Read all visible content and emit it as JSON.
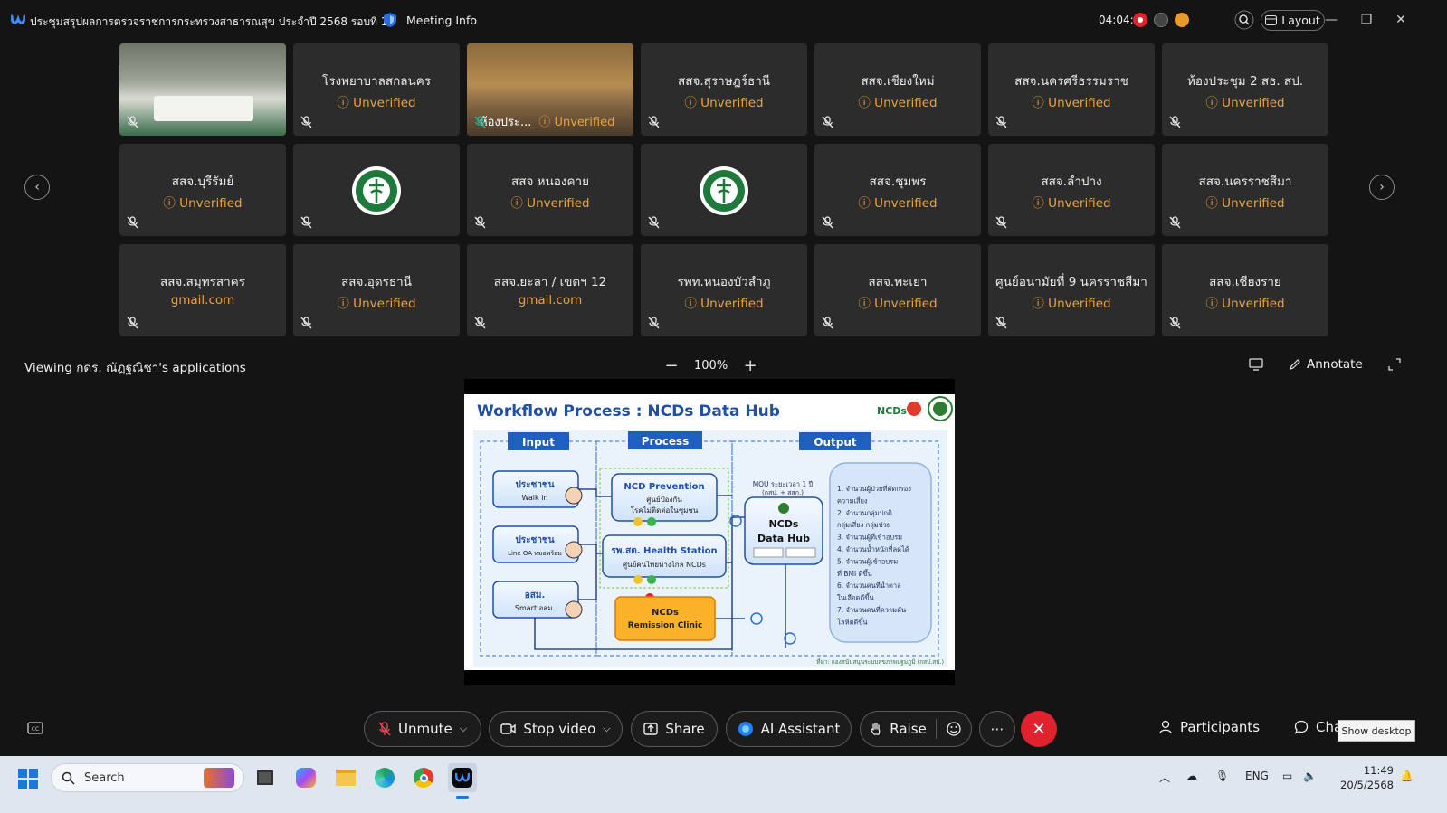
{
  "window": {
    "title": "ประชุมสรุปผลการตรวจราชการกระทรวงสาธารณสุข ประจำปี 2568 รอบที่ 1",
    "meeting_info": "Meeting Info",
    "timer": "04:04:44",
    "layout": "Layout"
  },
  "tiles": [
    {
      "name": "",
      "sub": "",
      "kind": "video-room"
    },
    {
      "name": "โรงพยาบาลสกลนคร",
      "sub": "ⓘ Unverified"
    },
    {
      "name": "ห้องประ...",
      "sub": "ⓘ Unverified",
      "kind": "video-active"
    },
    {
      "name": "สสจ.สุราษฎร์ธานี",
      "sub": "ⓘ Unverified"
    },
    {
      "name": "สสจ.เชียงใหม่",
      "sub": "ⓘ Unverified"
    },
    {
      "name": "สสจ.นครศรีธรรมราช",
      "sub": "ⓘ Unverified"
    },
    {
      "name": "ห้องประชุม 2 สธ. สป.",
      "sub": "ⓘ Unverified"
    },
    {
      "name": "สสจ.บุรีรัมย์",
      "sub": "ⓘ Unverified"
    },
    {
      "name": "",
      "sub": "",
      "kind": "logo"
    },
    {
      "name": "สสจ หนองคาย",
      "sub": "ⓘ Unverified"
    },
    {
      "name": "",
      "sub": "",
      "kind": "logo"
    },
    {
      "name": "สสจ.ชุมพร",
      "sub": "ⓘ Unverified"
    },
    {
      "name": "สสจ.ลำปาง",
      "sub": "ⓘ Unverified"
    },
    {
      "name": "สสจ.นครราชสีมา",
      "sub": "ⓘ Unverified"
    },
    {
      "name": "สสจ.สมุทรสาคร",
      "sub": "gmail.com"
    },
    {
      "name": "สสจ.อุดรธานี",
      "sub": "ⓘ Unverified"
    },
    {
      "name": "สสจ.ยะลา  / เขตฯ 12",
      "sub": "gmail.com"
    },
    {
      "name": "รพท.หนองบัวลำภู",
      "sub": "ⓘ Unverified"
    },
    {
      "name": "สสจ.พะเยา",
      "sub": "ⓘ Unverified"
    },
    {
      "name": "ศูนย์อนามัยที่ 9 นครราชสีมา",
      "sub": "ⓘ Unverified"
    },
    {
      "name": "สสจ.เชียงราย",
      "sub": "ⓘ Unverified"
    }
  ],
  "share": {
    "viewing": "Viewing กดร. ณัฏฐณิชา's applications",
    "zoom": "100%",
    "annotate": "Annotate"
  },
  "slide": {
    "title": "Workflow Process :  NCDs Data Hub",
    "input": "Input",
    "process": "Process",
    "output": "Output",
    "in1_a": "ประชาชน",
    "in1_b": "Walk in",
    "in2_a": "ประชาชน",
    "in2_b": "Line OA หมอพร้อม",
    "in3_a": "อสม.",
    "in3_b": "Smart อสม.",
    "p1_a": "NCD Prevention",
    "p1_b": "ศูนย์ป้องกัน",
    "p1_c": "โรคไม่ติดต่อในชุมชน",
    "p2_a": "รพ.สต. Health Station",
    "p2_b": "ศูนย์คนไทยห่างไกล NCDs",
    "p3_a": "NCDs",
    "p3_b": "Remission Clinic",
    "mou": "MOU ระยะเวลา 1 ปี",
    "mou2": "(กสป. + สสก.)",
    "hub_a": "NCDs",
    "hub_b": "Data Hub",
    "outputs": [
      "1.  จำนวนผู้ป่วยที่คัดกรอง",
      "     ความเสี่ยง",
      "2.  จำนวนกลุ่มปกติ",
      "     กลุ่มเสี่ยง กลุ่มป่วย",
      "3.  จำนวนผู้ที่เข้าอบรม",
      "4.  จำนวนน้ำหนักที่ลดได้",
      "5.  จำนวนผู้เข้าอบรม",
      "     ที่ BMI ดีขึ้น",
      "6.  จำนวนคนที่น้ำตาล",
      "     ในเลือดดีขึ้น",
      "7.  จำนวนคนที่ความดัน",
      "     โลหิตดีขึ้น"
    ],
    "source": "ที่มา: กองสนับสนุนระบบสุขภาพปฐมภูมิ (กสป.สป.)",
    "brand": "NCDs"
  },
  "toolbar": {
    "unmute": "Unmute",
    "stop_video": "Stop video",
    "share": "Share",
    "ai": "AI Assistant",
    "raise": "Raise",
    "participants": "Participants",
    "chat": "Chat",
    "tooltip": "Show desktop"
  },
  "taskbar": {
    "search": "Search",
    "lang": "ENG",
    "time": "11:49",
    "date": "20/5/2568"
  },
  "colors": {
    "accent": "#27b39a",
    "unverified": "#e8a33c",
    "leave": "#e0212e",
    "slide_blue": "#1f5fbf"
  }
}
